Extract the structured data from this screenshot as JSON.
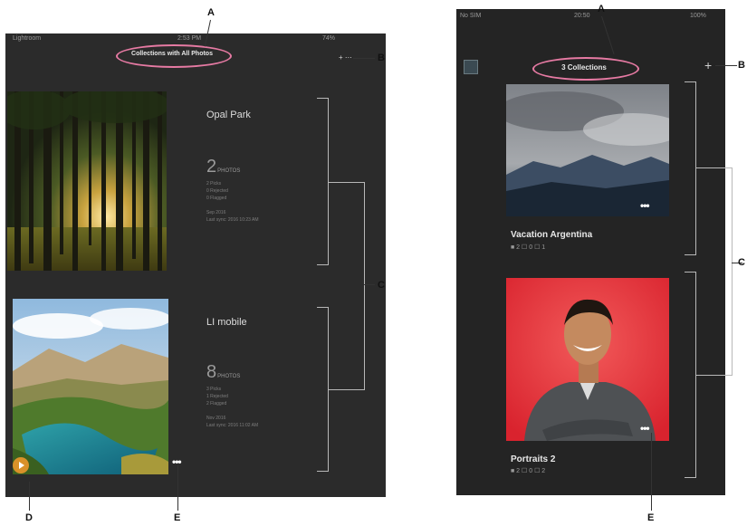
{
  "callouts": {
    "a1": "A",
    "a2": "A",
    "b1": "B",
    "b2": "B",
    "c1": "C",
    "c2": "C",
    "d": "D",
    "e1": "E",
    "e2": "E"
  },
  "tablet": {
    "status": {
      "left": "Lightroom",
      "time": "2:53 PM",
      "battery": "74%"
    },
    "title": "Collections with All Photos",
    "add_label": "+ ⋯",
    "collections": [
      {
        "name": "Opal Park",
        "count": "2",
        "count_label": "PHOTOS",
        "meta1": "2 Picks",
        "meta2": "0 Rejected",
        "meta3": "0 Flagged",
        "meta4": "Sep 2016",
        "meta5": "Last sync: 2016 10:23 AM"
      },
      {
        "name": "LI mobile",
        "count": "8",
        "count_label": "PHOTOS",
        "meta1": "3 Picks",
        "meta2": "1 Rejected",
        "meta3": "2 Flagged",
        "meta4": "Nov 2016",
        "meta5": "Last sync: 2016 11:02 AM"
      }
    ],
    "more_label": "•••"
  },
  "phone": {
    "status": {
      "carrier": "No SIM",
      "time": "20:50",
      "battery": "100%"
    },
    "title": "3 Collections",
    "add_label": "+",
    "collections": [
      {
        "name": "Vacation Argentina",
        "meta": "■ 2  ☐ 0  ☐ 1"
      },
      {
        "name": "Portraits 2",
        "meta": "■ 2  ☐ 0  ☐ 2"
      }
    ],
    "more_label": "•••"
  },
  "colors": {
    "accent": "#e67aa3",
    "bg_dark": "#2b2b2b"
  }
}
